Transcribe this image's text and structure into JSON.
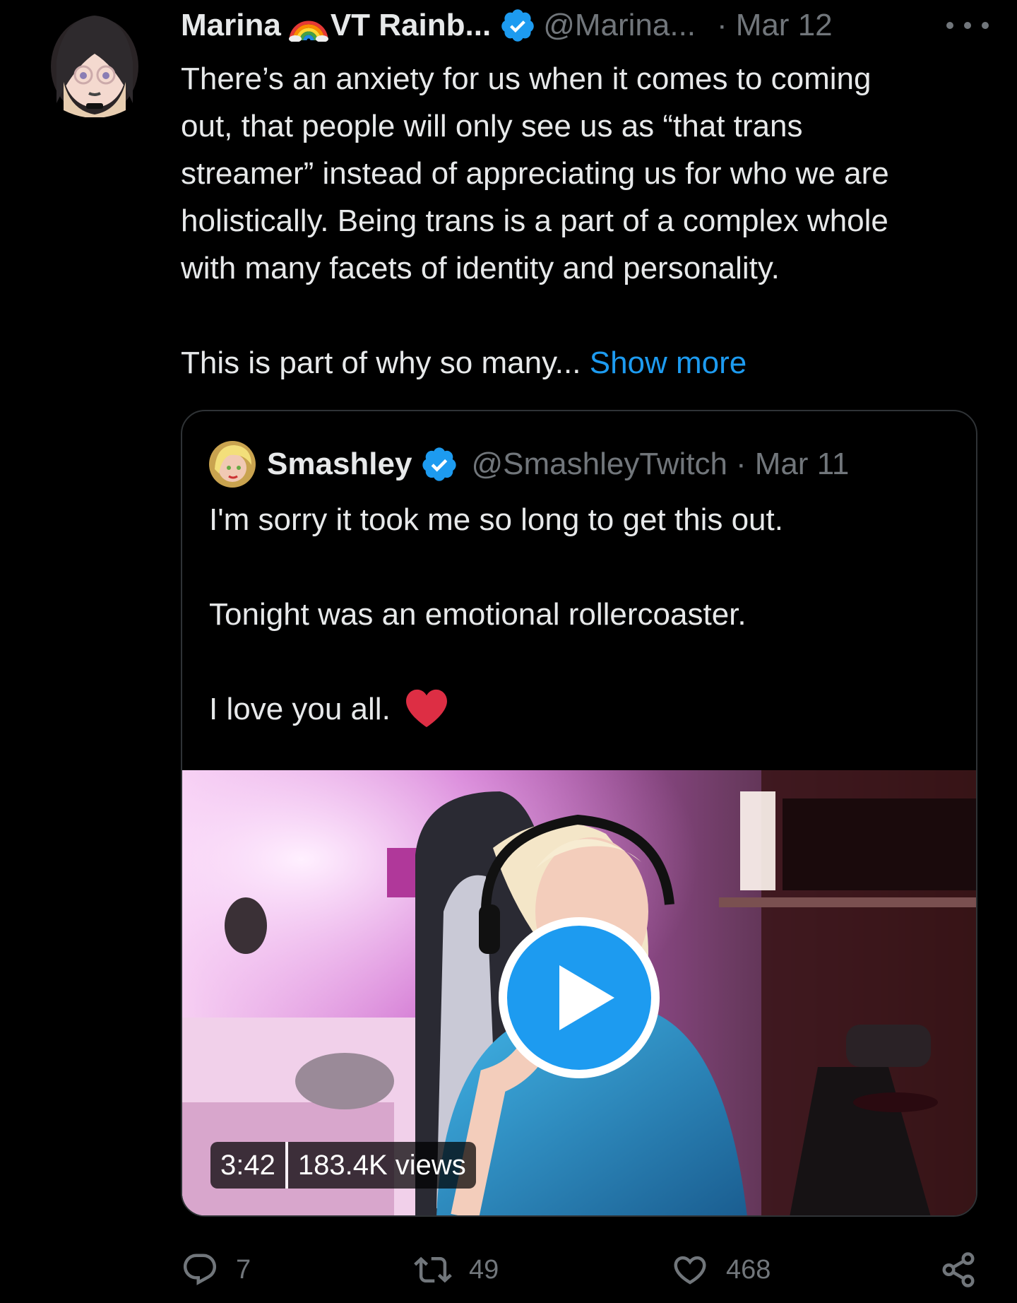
{
  "tweet": {
    "author_name": "Marina",
    "author_name_suffix": "VT Rainb...",
    "handle": "@Marina...",
    "separator": "·",
    "date": "Mar 12",
    "text_lines": [
      "There’s an anxiety for us when it comes to coming",
      "out, that people will only see us as “that trans",
      "streamer” instead of appreciating us for who we are",
      "holistically. Being trans is a part of a complex whole",
      "with many facets of identity and personality."
    ],
    "text_truncated": "This is part of why so many...",
    "show_more_label": "Show more"
  },
  "quoted": {
    "author_name": "Smashley",
    "handle": "@SmashleyTwitch",
    "separator": "·",
    "date": "Mar 11",
    "line1": "I'm sorry it took me so long to get this out.",
    "line2": "Tonight was an emotional rollercoaster.",
    "line3": "I love you all.",
    "video": {
      "duration": "3:42",
      "views": "183.4K views"
    }
  },
  "actions": {
    "replies": "7",
    "retweets": "49",
    "likes": "468"
  },
  "colors": {
    "background": "#000000",
    "text": "#e7e9ea",
    "muted": "#71767b",
    "accent": "#1d9bf0",
    "border": "#2f3336",
    "heart": "#e0245e"
  },
  "icons": [
    "more-icon",
    "verified-icon",
    "rainbow-emoji",
    "heart-emoji",
    "play-icon",
    "reply-icon",
    "retweet-icon",
    "like-icon",
    "share-icon"
  ]
}
